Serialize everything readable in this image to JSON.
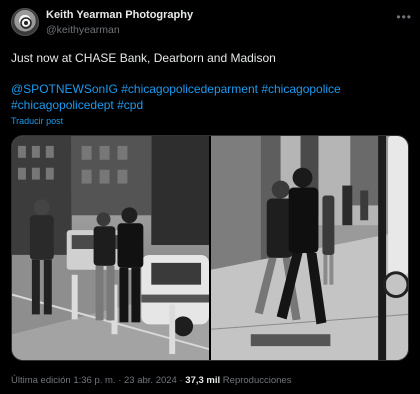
{
  "author": {
    "display_name": "Keith Yearman Photography",
    "handle": "@keithyearman",
    "avatar_icon": "camera-logo-icon"
  },
  "more_icon": "ellipsis-icon",
  "tweet": {
    "line1": "Just now at CHASE Bank, Dearborn and Madison",
    "hashtags_line1": [
      "@SPOTNEWSonIG",
      "#chicagopolicedeparment",
      "#chicagopolice"
    ],
    "hashtags_line2": [
      "#chicagopolicedept",
      "#cpd"
    ],
    "translate": "Traducir post"
  },
  "media": {
    "count": 2,
    "photo_left": "street-arrest-photo",
    "photo_right": "sidewalk-escort-photo"
  },
  "meta": {
    "edited_label": "Última edición",
    "time": "1:36 p. m.",
    "separator": "·",
    "date": "23 abr. 2024",
    "views": "37,3 mil",
    "views_label": "Reproducciones"
  },
  "colors": {
    "background": "#000000",
    "text": "#e7e9ea",
    "muted": "#71767b",
    "link": "#1d9bf0"
  }
}
